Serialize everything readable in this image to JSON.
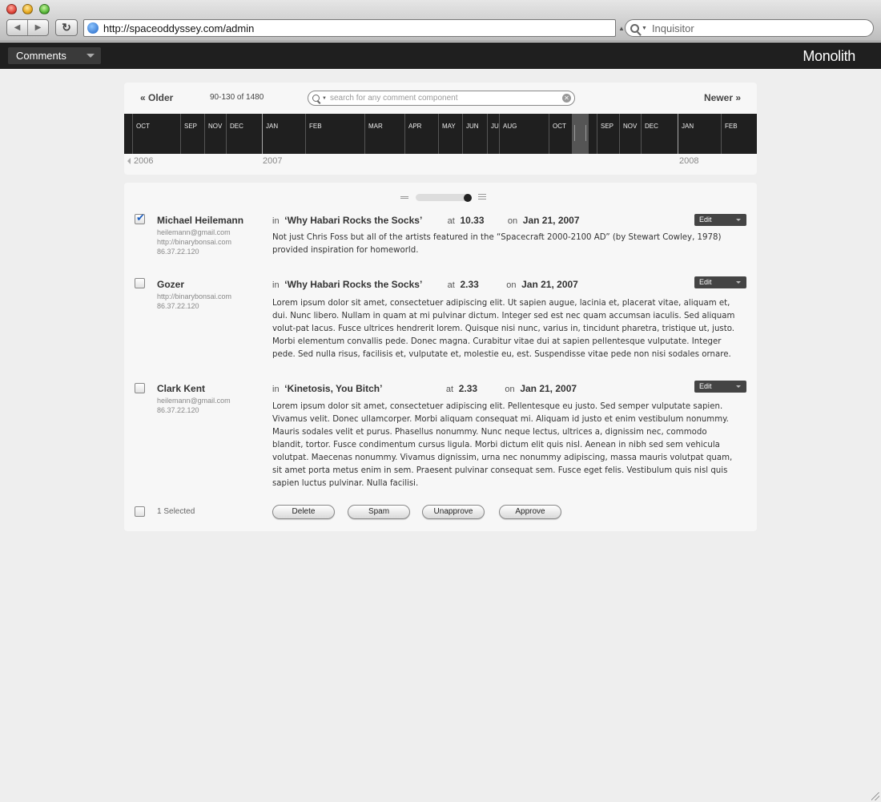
{
  "browser": {
    "url": "http://spaceoddyssey.com/admin",
    "search_placeholder": "Inquisitor"
  },
  "appbar": {
    "section": "Comments",
    "brand": "Monolith"
  },
  "toolbar": {
    "older": "« Older",
    "count": "90-130 of 1480",
    "search_placeholder": "search for any comment component",
    "newer": "Newer »"
  },
  "timeline": {
    "months": [
      "OCT",
      "SEP",
      "NOV",
      "DEC",
      "JAN",
      "FEB",
      "MAR",
      "APR",
      "MAY",
      "JUN",
      "JU",
      "AUG",
      "OCT",
      "SEP",
      "NOV",
      "DEC",
      "JAN",
      "FEB"
    ],
    "years": [
      "2006",
      "2007",
      "2008"
    ]
  },
  "comments": [
    {
      "checked": true,
      "author": "Michael Heilemann",
      "email": "heilemann@gmail.com",
      "url": "http://binarybonsai.com",
      "ip": "86.37.22.120",
      "in_label": "in",
      "post": "‘Why Habari Rocks the Socks’",
      "at_label": "at",
      "time": "10.33",
      "on_label": "on",
      "date": "Jan 21, 2007",
      "edit": "Edit",
      "text": "Not just Chris Foss but all of the artists featured in the “Spacecraft 2000-2100 AD” (by Stewart Cowley, 1978) provided inspiration for homeworld."
    },
    {
      "checked": false,
      "author": "Gozer",
      "email": "",
      "url": "http://binarybonsai.com",
      "ip": "86.37.22.120",
      "in_label": "in",
      "post": "‘Why Habari Rocks the Socks’",
      "at_label": "at",
      "time": "2.33",
      "on_label": "on",
      "date": "Jan 21, 2007",
      "edit": "Edit",
      "text": "Lorem ipsum dolor sit amet, consectetuer adipiscing elit. Ut sapien augue, lacinia et, placerat vitae, aliquam et, dui. Nunc libero. Nullam in quam at mi pulvinar dictum. Integer sed est nec quam accumsan iaculis. Sed aliquam volut-pat lacus. Fusce ultrices hendrerit lorem. Quisque nisi nunc, varius in, tincidunt pharetra, tristique ut, justo. Morbi elementum convallis pede. Donec magna. Curabitur vitae dui at sapien pellentesque vulputate. Integer pede. Sed nulla risus, facilisis et, vulputate et, molestie eu, est. Suspendisse vitae pede non nisi sodales ornare."
    },
    {
      "checked": false,
      "author": "Clark Kent",
      "email": "heilemann@gmail.com",
      "url": "",
      "ip": "86.37.22.120",
      "in_label": "in",
      "post": "‘Kinetosis, You Bitch’",
      "at_label": "at",
      "time": "2.33",
      "on_label": "on",
      "date": "Jan 21, 2007",
      "edit": "Edit",
      "text": "Lorem ipsum dolor sit amet, consectetuer adipiscing elit. Pellentesque eu justo. Sed semper vulputate sapien. Vivamus velit. Donec ullamcorper. Morbi aliquam consequat mi. Aliquam id justo et enim vestibulum nonummy. Mauris sodales velit et purus. Phasellus nonummy. Nunc neque lectus, ultrices a, dignissim nec, commodo blandit, tortor. Fusce condimentum cursus ligula. Morbi dictum elit quis nisl. Aenean in nibh sed sem vehicula volutpat. Maecenas nonummy. Vivamus dignissim, urna nec nonummy adipiscing, massa mauris volutpat quam, sit amet porta metus enim in sem. Praesent pulvinar consequat sem. Fusce eget felis. Vestibulum quis nisl quis sapien luctus pulvinar. Nulla facilisi."
    }
  ],
  "footer": {
    "selected": "1 Selected",
    "actions": [
      "Delete",
      "Spam",
      "Unapprove",
      "Approve"
    ]
  }
}
